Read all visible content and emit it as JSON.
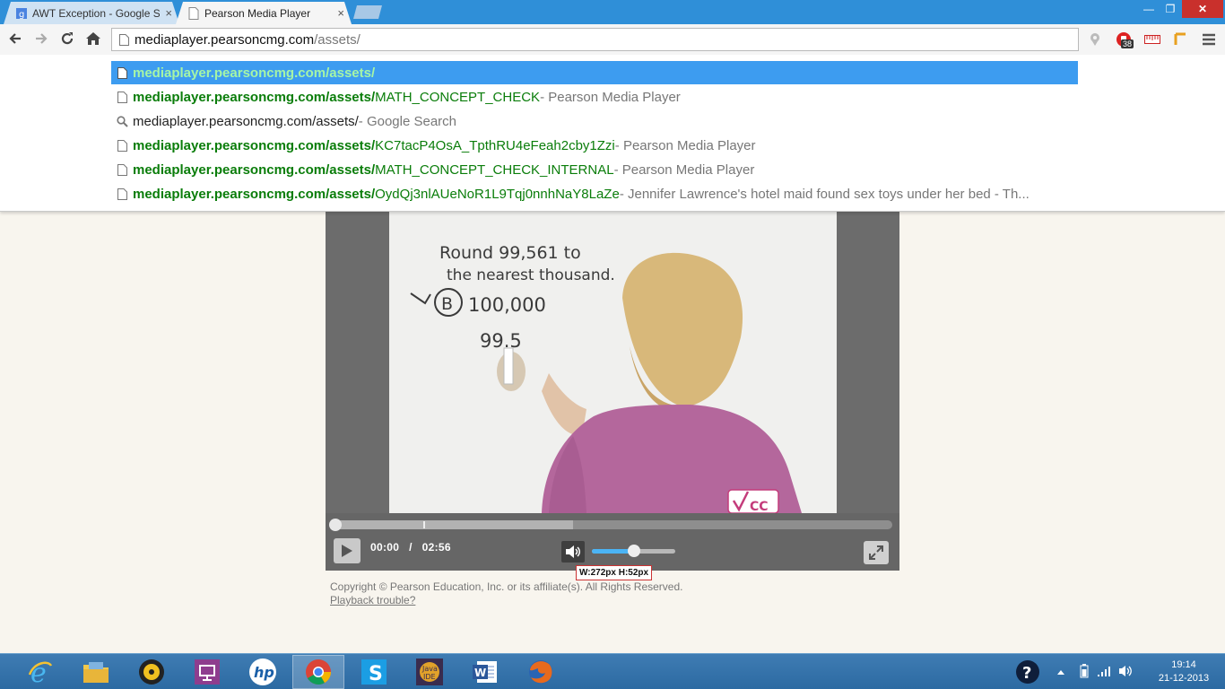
{
  "browser": {
    "tabs": [
      {
        "label": "AWT Exception - Google S",
        "icon": "google-icon",
        "active": false
      },
      {
        "label": "Pearson Media Player",
        "icon": "page-icon",
        "active": true
      }
    ],
    "window": {
      "minimize": "—",
      "maximize": "❐",
      "close": "✕"
    }
  },
  "address": {
    "host": "mediaplayer.pearsoncmg.com",
    "path": "/assets/",
    "extension_badge": "38"
  },
  "suggestions": [
    {
      "icon": "page-icon",
      "url_bold": "mediaplayer.pearsoncmg.com/assets/",
      "url_rest": "",
      "desc": "",
      "selected": true
    },
    {
      "icon": "page-icon",
      "url_bold": "mediaplayer.pearsoncmg.com/assets/",
      "url_rest": "MATH_CONCEPT_CHECK",
      "desc": " - Pearson Media Player"
    },
    {
      "icon": "search-icon",
      "text": "mediaplayer.pearsoncmg.com/assets/",
      "desc": " - Google Search"
    },
    {
      "icon": "page-icon",
      "url_bold": "mediaplayer.pearsoncmg.com/assets/",
      "url_rest": "KC7tacP4OsA_TpthRU4eFeah2cby1Zzi",
      "desc": " - Pearson Media Player"
    },
    {
      "icon": "page-icon",
      "url_bold": "mediaplayer.pearsoncmg.com/assets/",
      "url_rest": "MATH_CONCEPT_CHECK_INTERNAL",
      "desc": " - Pearson Media Player"
    },
    {
      "icon": "page-icon",
      "url_bold": "mediaplayer.pearsoncmg.com/assets/",
      "url_rest": "OydQj3nlAUeNoR1L9Tqj0nnhNaY8LaZe",
      "desc": " - Jennifer Lawrence's hotel maid found sex toys under her bed - Th..."
    }
  ],
  "video": {
    "whiteboard": {
      "line1": "Round 99,561 to",
      "line2": "the nearest thousand.",
      "choice_letter": "B",
      "choice_value": "100,000",
      "scratch": "99.5"
    },
    "cc_logo": "CC"
  },
  "player": {
    "current_time": "00:00",
    "separator": "/",
    "duration": "02:56",
    "progress": 0.0,
    "buffered": 0.43,
    "volume": 0.5
  },
  "measure_tooltip": "W:272px H:52px",
  "footer": {
    "copyright": "Copyright © Pearson Education, Inc. or its affiliate(s). All Rights Reserved.",
    "trouble_link": "Playback trouble?"
  },
  "taskbar": {
    "apps": [
      "ie-icon",
      "file-explorer-icon",
      "media-player-icon",
      "connect-icon",
      "hp-icon",
      "chrome-icon",
      "skype-icon",
      "java-ee-ide-icon",
      "word-icon",
      "firefox-icon"
    ],
    "active_app": "chrome-icon",
    "clock_time": "19:14",
    "clock_date": "21-12-2013"
  }
}
